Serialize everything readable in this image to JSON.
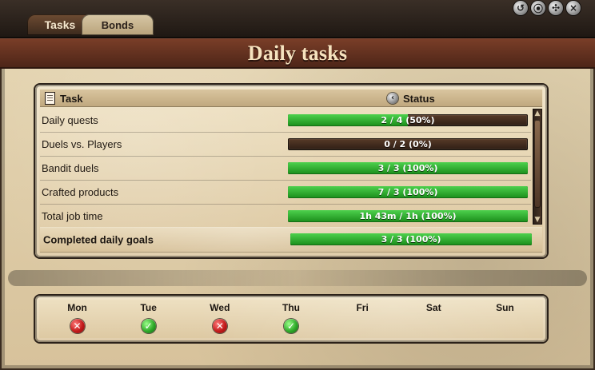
{
  "tabs": [
    {
      "label": "Tasks",
      "active": true
    },
    {
      "label": "Bonds",
      "active": false
    }
  ],
  "window_controls": {
    "icons": [
      {
        "name": "history-icon",
        "glyph": "↺"
      },
      {
        "name": "info-icon",
        "glyph": "⦿"
      },
      {
        "name": "settings-icon",
        "glyph": "✣"
      },
      {
        "name": "close-icon",
        "glyph": "×"
      }
    ]
  },
  "title": "Daily tasks",
  "table": {
    "headers": {
      "task": "Task",
      "status": "Status"
    },
    "rows": [
      {
        "label": "Daily quests",
        "progress_text": "2 / 4 (50%)",
        "progress_pct": 50
      },
      {
        "label": "Duels vs. Players",
        "progress_text": "0 / 2 (0%)",
        "progress_pct": 0
      },
      {
        "label": "Bandit duels",
        "progress_text": "3 / 3 (100%)",
        "progress_pct": 100
      },
      {
        "label": "Crafted products",
        "progress_text": "7 / 3 (100%)",
        "progress_pct": 100
      },
      {
        "label": "Total job time",
        "progress_text": "1h 43m / 1h (100%)",
        "progress_pct": 100
      }
    ],
    "completed": {
      "label": "Completed daily goals",
      "progress_text": "3 / 3 (100%)",
      "progress_pct": 100
    }
  },
  "week": {
    "days": [
      {
        "label": "Mon",
        "status": "fail"
      },
      {
        "label": "Tue",
        "status": "success"
      },
      {
        "label": "Wed",
        "status": "fail"
      },
      {
        "label": "Thu",
        "status": "success"
      },
      {
        "label": "Fri",
        "status": "none"
      },
      {
        "label": "Sat",
        "status": "none"
      },
      {
        "label": "Sun",
        "status": "none"
      }
    ],
    "marks": {
      "fail": "✕",
      "success": "✓"
    }
  }
}
